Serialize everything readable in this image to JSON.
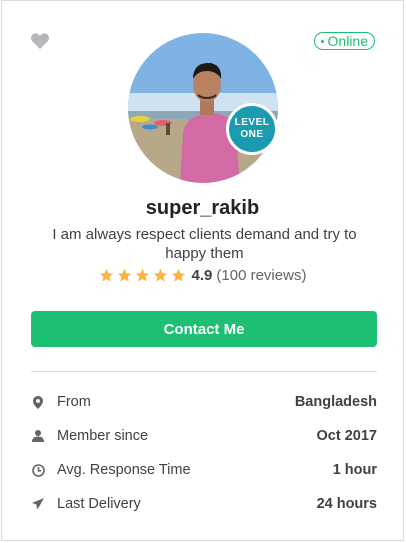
{
  "status": {
    "label": "Online",
    "color": "#1dbf73"
  },
  "icons": {
    "favorite": "heart-icon"
  },
  "profile": {
    "level_line1": "LEVEL",
    "level_line2": "ONE",
    "username": "super_rakib",
    "bio": "I am always respect clients demand and try to happy them",
    "rating": {
      "stars": 5,
      "score": "4.9",
      "reviews": "(100 reviews)"
    }
  },
  "contact_button": {
    "label": "Contact Me",
    "color": "#1dbf73"
  },
  "stats": [
    {
      "icon": "location-pin-icon",
      "label": "From",
      "value": "Bangladesh"
    },
    {
      "icon": "user-icon",
      "label": "Member since",
      "value": "Oct 2017"
    },
    {
      "icon": "clock-icon",
      "label": "Avg. Response Time",
      "value": "1 hour"
    },
    {
      "icon": "send-icon",
      "label": "Last Delivery",
      "value": "24 hours"
    }
  ]
}
